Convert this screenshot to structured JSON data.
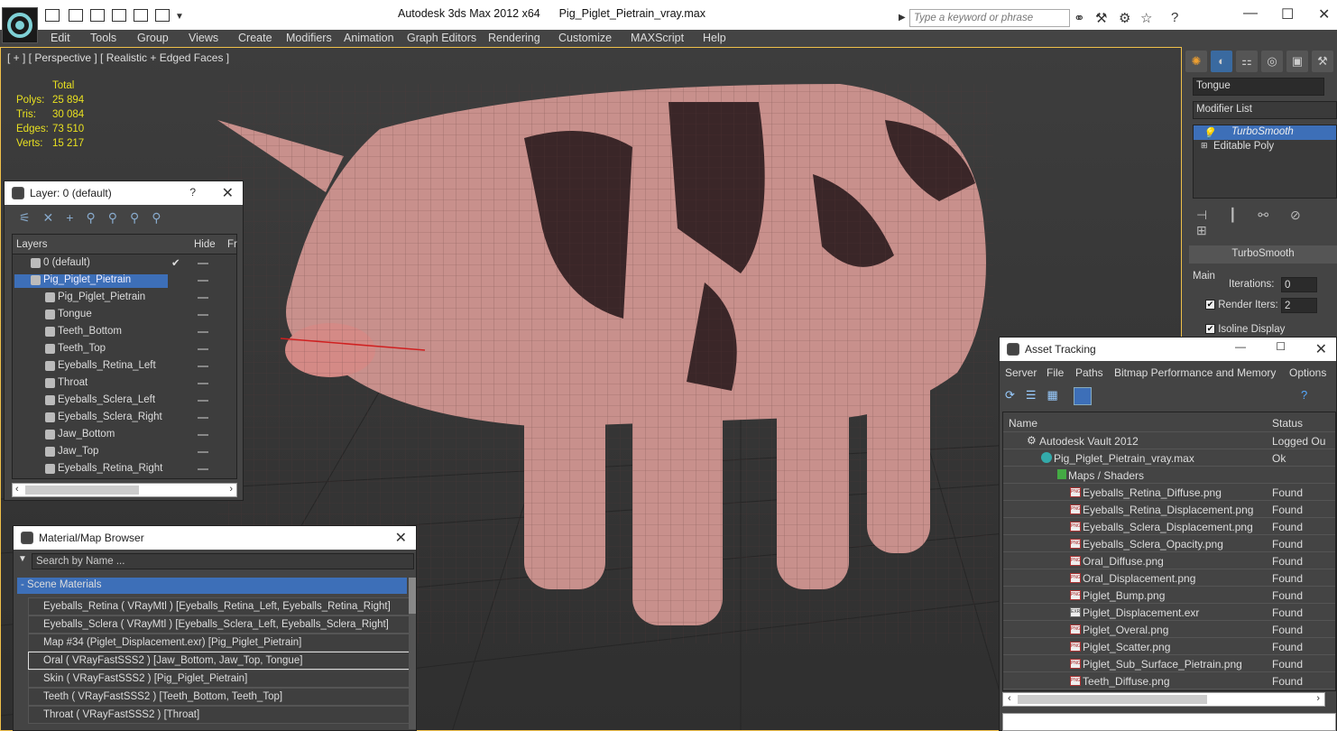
{
  "app": {
    "title": "Autodesk 3ds Max  2012 x64",
    "filename": "Pig_Piglet_Pietrain_vray.max",
    "search_placeholder": "Type a keyword or phrase"
  },
  "menu": [
    "Edit",
    "Tools",
    "Group",
    "Views",
    "Create",
    "Modifiers",
    "Animation",
    "Graph Editors",
    "Rendering",
    "Customize",
    "MAXScript",
    "Help"
  ],
  "viewport": {
    "label": "[ + ] [ Perspective ] [ Realistic + Edged Faces ]",
    "stats": {
      "header": "Total",
      "rows": [
        {
          "k": "Polys:",
          "v": "25 894"
        },
        {
          "k": "Tris:",
          "v": "30 084"
        },
        {
          "k": "Edges:",
          "v": "73 510"
        },
        {
          "k": "Verts:",
          "v": "15 217"
        }
      ]
    }
  },
  "layers": {
    "title": "Layer: 0 (default)",
    "help": "?",
    "col_layers": "Layers",
    "col_hide": "Hide",
    "col_fr": "Fr",
    "rows": [
      "0 (default)",
      "Pig_Piglet_Pietrain",
      "Pig_Piglet_Pietrain",
      "Tongue",
      "Teeth_Bottom",
      "Teeth_Top",
      "Eyeballs_Retina_Left",
      "Throat",
      "Eyeballs_Sclera_Left",
      "Eyeballs_Sclera_Right",
      "Jaw_Bottom",
      "Jaw_Top",
      "Eyeballs_Retina_Right"
    ]
  },
  "materials": {
    "title": "Material/Map Browser",
    "search_placeholder": "Search by Name ...",
    "group": "- Scene Materials",
    "rows": [
      "Eyeballs_Retina  ( VRayMtl )  [Eyeballs_Retina_Left, Eyeballs_Retina_Right]",
      "Eyeballs_Sclera  ( VRayMtl )  [Eyeballs_Sclera_Left, Eyeballs_Sclera_Right]",
      "Map #34 (Piglet_Displacement.exr)  [Pig_Piglet_Pietrain]",
      "Oral  ( VRayFastSSS2 )  [Jaw_Bottom, Jaw_Top, Tongue]",
      "Skin  ( VRayFastSSS2 )  [Pig_Piglet_Pietrain]",
      "Teeth  ( VRayFastSSS2 )  [Teeth_Bottom, Teeth_Top]",
      "Throat  ( VRayFastSSS2 )  [Throat]"
    ]
  },
  "asset": {
    "title": "Asset Tracking",
    "menu": [
      "Server",
      "File",
      "Paths",
      "Bitmap Performance and Memory",
      "Options"
    ],
    "col_name": "Name",
    "col_status": "Status",
    "rows": [
      {
        "n": "Autodesk Vault 2012",
        "s": "Logged Ou"
      },
      {
        "n": "Pig_Piglet_Pietrain_vray.max",
        "s": "Ok"
      },
      {
        "n": "Maps / Shaders",
        "s": ""
      },
      {
        "n": "Eyeballs_Retina_Diffuse.png",
        "s": "Found"
      },
      {
        "n": "Eyeballs_Retina_Displacement.png",
        "s": "Found"
      },
      {
        "n": "Eyeballs_Sclera_Displacement.png",
        "s": "Found"
      },
      {
        "n": "Eyeballs_Sclera_Opacity.png",
        "s": "Found"
      },
      {
        "n": "Oral_Diffuse.png",
        "s": "Found"
      },
      {
        "n": "Oral_Displacement.png",
        "s": "Found"
      },
      {
        "n": "Piglet_Bump.png",
        "s": "Found"
      },
      {
        "n": "Piglet_Displacement.exr",
        "s": "Found"
      },
      {
        "n": "Piglet_Overal.png",
        "s": "Found"
      },
      {
        "n": "Piglet_Scatter.png",
        "s": "Found"
      },
      {
        "n": "Piglet_Sub_Surface_Pietrain.png",
        "s": "Found"
      },
      {
        "n": "Teeth_Diffuse.png",
        "s": "Found"
      }
    ]
  },
  "command": {
    "object_name": "Tongue",
    "modifier_list": "Modifier List",
    "stack": [
      "TurboSmooth",
      "Editable Poly"
    ],
    "rollout": "TurboSmooth",
    "group_main": "Main",
    "iterations_label": "Iterations:",
    "iterations": "0",
    "render_iters_label": "Render Iters:",
    "render_iters": "2",
    "isoline": "Isoline Display"
  }
}
